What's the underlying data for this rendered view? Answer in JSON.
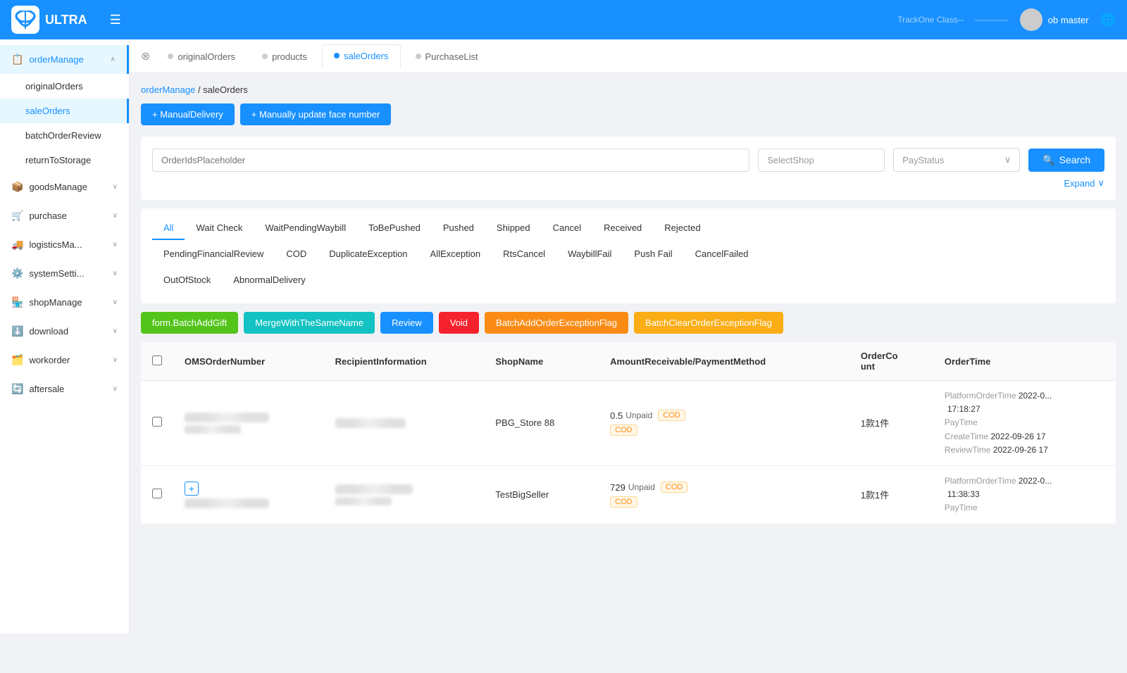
{
  "navbar": {
    "logo_text": "ULTRA",
    "menu_icon": "☰",
    "user_name": "ob master",
    "lang_icon": "🌐"
  },
  "sidebar": {
    "items": [
      {
        "id": "orderManage",
        "label": "orderManage",
        "icon": "📋",
        "active": true,
        "expandable": true
      },
      {
        "id": "originalOrders",
        "label": "originalOrders",
        "icon": "",
        "sub": true
      },
      {
        "id": "saleOrders",
        "label": "saleOrders",
        "icon": "",
        "sub": true,
        "active": true
      },
      {
        "id": "batchOrderReview",
        "label": "batchOrderReview",
        "icon": "",
        "sub": true
      },
      {
        "id": "returnToStorage",
        "label": "returnToStorage",
        "icon": "",
        "sub": true
      },
      {
        "id": "goodsManage",
        "label": "goodsManage",
        "icon": "📦",
        "expandable": true
      },
      {
        "id": "purchase",
        "label": "purchase",
        "icon": "🛒",
        "expandable": true
      },
      {
        "id": "logisticsMa",
        "label": "logisticsMa...",
        "icon": "🚚",
        "expandable": true
      },
      {
        "id": "systemSetti",
        "label": "systemSetti...",
        "icon": "⚙️",
        "expandable": true
      },
      {
        "id": "shopManage",
        "label": "shopManage",
        "icon": "🏪",
        "expandable": true
      },
      {
        "id": "download",
        "label": "download",
        "icon": "⬇️",
        "expandable": true
      },
      {
        "id": "workorder",
        "label": "workorder",
        "icon": "🗂️",
        "expandable": true
      },
      {
        "id": "aftersale",
        "label": "aftersale",
        "icon": "🔄",
        "expandable": true
      }
    ]
  },
  "tabs": [
    {
      "id": "originalOrders",
      "label": "originalOrders",
      "active": false,
      "dot_active": false
    },
    {
      "id": "products",
      "label": "products",
      "active": false,
      "dot_active": false
    },
    {
      "id": "saleOrders",
      "label": "saleOrders",
      "active": true,
      "dot_active": true
    },
    {
      "id": "PurchaseList",
      "label": "PurchaseList",
      "active": false,
      "dot_active": false
    }
  ],
  "breadcrumb": {
    "parent": "orderManage",
    "separator": "/",
    "current": "saleOrders"
  },
  "actions": {
    "manual_delivery": "+ ManualDelivery",
    "manually_update": "+ Manually update face number"
  },
  "filters": {
    "order_ids_placeholder": "OrderIdsPlaceholder",
    "select_shop_placeholder": "SelectShop",
    "pay_status_placeholder": "PayStatus",
    "search_label": "Search",
    "expand_label": "Expand"
  },
  "status_tabs": {
    "row1": [
      {
        "id": "all",
        "label": "All",
        "active": true
      },
      {
        "id": "waitCheck",
        "label": "Wait Check"
      },
      {
        "id": "waitPendingWaybill",
        "label": "WaitPendingWaybill"
      },
      {
        "id": "toBePushed",
        "label": "ToBePushed"
      },
      {
        "id": "pushed",
        "label": "Pushed"
      },
      {
        "id": "shipped",
        "label": "Shipped"
      },
      {
        "id": "cancel",
        "label": "Cancel"
      },
      {
        "id": "received",
        "label": "Received"
      },
      {
        "id": "rejected",
        "label": "Rejected"
      }
    ],
    "row2": [
      {
        "id": "pendingFinancialReview",
        "label": "PendingFinancialReview"
      },
      {
        "id": "cod",
        "label": "COD"
      },
      {
        "id": "duplicateException",
        "label": "DuplicateException"
      },
      {
        "id": "allException",
        "label": "AllException"
      },
      {
        "id": "rtsCancel",
        "label": "RtsCancel"
      },
      {
        "id": "waybillFail",
        "label": "WaybillFail"
      },
      {
        "id": "pushFail",
        "label": "Push Fail"
      },
      {
        "id": "cancelFailed",
        "label": "CancelFailed"
      }
    ],
    "row3": [
      {
        "id": "outOfStock",
        "label": "OutOfStock"
      },
      {
        "id": "abnormalDelivery",
        "label": "AbnormalDelivery"
      }
    ]
  },
  "action_buttons": [
    {
      "id": "batchAddGift",
      "label": "form.BatchAddGift",
      "color": "green"
    },
    {
      "id": "mergeWithSameName",
      "label": "MergeWithTheSameName",
      "color": "teal"
    },
    {
      "id": "review",
      "label": "Review",
      "color": "blue"
    },
    {
      "id": "void",
      "label": "Void",
      "color": "red"
    },
    {
      "id": "batchAddOrderExceptionFlag",
      "label": "BatchAddOrderExceptionFlag",
      "color": "orange"
    },
    {
      "id": "batchClearOrderExceptionFlag",
      "label": "BatchClearOrderExceptionFlag",
      "color": "yellow"
    }
  ],
  "table": {
    "columns": [
      {
        "id": "checkbox",
        "label": ""
      },
      {
        "id": "omsOrderNumber",
        "label": "OMSOrderNumber"
      },
      {
        "id": "recipientInformation",
        "label": "RecipientInformation"
      },
      {
        "id": "shopName",
        "label": "ShopName"
      },
      {
        "id": "amountPayment",
        "label": "AmountReceivable/PaymentMethod"
      },
      {
        "id": "orderCount",
        "label": "OrderCount"
      },
      {
        "id": "orderTime",
        "label": "OrderTime"
      }
    ],
    "rows": [
      {
        "id": "row1",
        "omsOrderNumber": "",
        "recipientInfo": "",
        "shopName": "PBG_Store 88",
        "amount": "0.5",
        "payStatus": "Unpaid",
        "cod1": "COD",
        "cod2": "COD",
        "orderCount": "1款1件",
        "platformOrderTime_label": "PlatformOrderTime",
        "platformOrderTime": "2022-0",
        "platformOrderTime_suffix": "17:18:27",
        "payTime_label": "PayTime",
        "createTime_label": "CreateTime",
        "createTime": "2022-09-26 17",
        "reviewTime_label": "ReviewTime",
        "reviewTime": "2022-09-26 17"
      },
      {
        "id": "row2",
        "omsOrderNumber": "",
        "recipientInfo": "",
        "shopName": "TestBigSeller",
        "amount": "729",
        "payStatus": "Unpaid",
        "cod1": "COD",
        "cod2": "COD",
        "orderCount": "1款1件",
        "platformOrderTime_label": "PlatformOrderTime",
        "platformOrderTime": "2022-0",
        "platformOrderTime_suffix": "11:38:33",
        "payTime_label": "PayTime"
      }
    ]
  }
}
